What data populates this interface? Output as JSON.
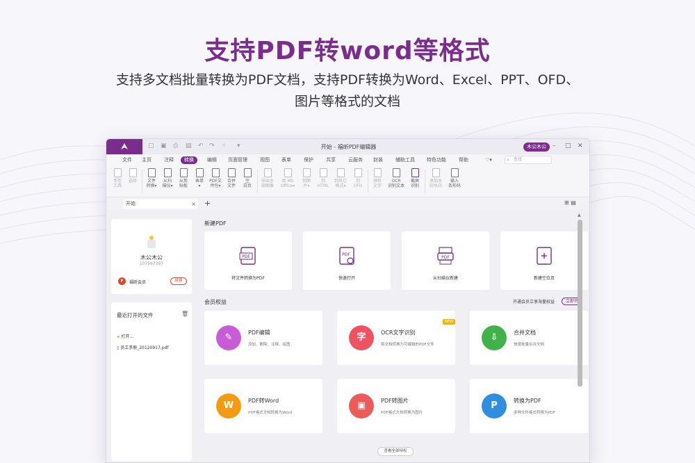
{
  "hero": {
    "title": "支持PDF转word等格式",
    "subtitle_line1": "支持多文档批量转换为PDF文档，支持PDF转换为Word、Excel、PPT、OFD、",
    "subtitle_line2": "图片等格式的文档"
  },
  "window": {
    "title": "开始 - 福昕PDF编辑器",
    "user_pill": "木公木公",
    "controls": [
      "–",
      "□",
      "✕"
    ]
  },
  "menu": {
    "items": [
      "文件",
      "主页",
      "注释",
      "转换",
      "编辑",
      "页面管理",
      "视图",
      "表单",
      "保护",
      "共享",
      "云服务",
      "封装",
      "辅助工具",
      "特色功能",
      "帮助"
    ],
    "active": "转换",
    "search_placeholder": "查找"
  },
  "ribbon": {
    "buttons": [
      {
        "label1": "手型",
        "label2": "工具",
        "disabled": true
      },
      {
        "label1": "选择",
        "label2": "",
        "disabled": true
      },
      {
        "label1": "文件",
        "label2": "转换▾",
        "disabled": false
      },
      {
        "label1": "从扫",
        "label2": "描仪▾",
        "disabled": false
      },
      {
        "label1": "从剪",
        "label2": "贴板",
        "disabled": false
      },
      {
        "label1": "表单",
        "label2": "▾",
        "disabled": false
      },
      {
        "label1": "PDF文",
        "label2": "件包▾",
        "disabled": false
      },
      {
        "label1": "合并",
        "label2": "文件",
        "disabled": false
      },
      {
        "label1": "空",
        "label2": "白页",
        "disabled": false
      },
      {
        "label1": "导出全",
        "label2": "部图像",
        "disabled": true
      },
      {
        "label1": "到 MS",
        "label2": "Office▾",
        "disabled": true
      },
      {
        "label1": "到图",
        "label2": "片▾",
        "disabled": true
      },
      {
        "label1": "到",
        "label2": "HTML",
        "disabled": true
      },
      {
        "label1": "到其它",
        "label2": "格式▾",
        "disabled": true
      },
      {
        "label1": "到",
        "label2": "OFD",
        "disabled": true
      },
      {
        "label1": "预检",
        "label2": "文字",
        "disabled": true
      },
      {
        "label1": "OCR",
        "label2": "识别文本",
        "disabled": false
      },
      {
        "label1": "截屏",
        "label2": "识别",
        "disabled": false
      },
      {
        "label1": "添加水",
        "label2": "印水印",
        "disabled": true
      },
      {
        "label1": "输入",
        "label2": "条形码",
        "disabled": false
      }
    ]
  },
  "doc_tab": {
    "label": "开始",
    "close": "×",
    "new_tab": "+"
  },
  "user_panel": {
    "name": "木公木公",
    "id": "107567397",
    "vip_label": "福昕会员",
    "vip_badge": "F",
    "vip_button": "续费"
  },
  "recent": {
    "title": "最近打开的文件",
    "open_label": "打开...",
    "files": [
      "员工手册_20120917.pdf"
    ]
  },
  "new_pdf": {
    "title": "新建PDF",
    "cards": [
      "将文件转换为PDF",
      "快速打开",
      "从扫描仪新建",
      "新建空白页"
    ]
  },
  "member": {
    "title": "会员权益",
    "promo_text": "开通会员立享海量权益",
    "promo_button": "立即开",
    "new_badge": "NEW",
    "features": [
      {
        "name": "PDF编辑",
        "desc": "添加、删除、注释、绘图",
        "color": "#c75cd6",
        "glyph": "✎"
      },
      {
        "name": "OCR文字识别",
        "desc": "将文档转换为可编辑的PDF文件",
        "color": "#ef5260",
        "glyph": "字"
      },
      {
        "name": "合并文档",
        "desc": "快速批量合并文档",
        "color": "#3fb24a",
        "glyph": "⇩"
      },
      {
        "name": "PDF转Word",
        "desc": "PDF格式文档转换为Word",
        "color": "#f59b12",
        "glyph": "W"
      },
      {
        "name": "PDF转图片",
        "desc": "PDF格式文档转换为图片",
        "color": "#ee5a5a",
        "glyph": "▣"
      },
      {
        "name": "转换为PDF",
        "desc": "多种文件格式转换为PDF",
        "color": "#2f8ee0",
        "glyph": "P"
      }
    ],
    "view_all": "查看全部特权"
  },
  "colors": {
    "brand": "#7b2d8e"
  }
}
